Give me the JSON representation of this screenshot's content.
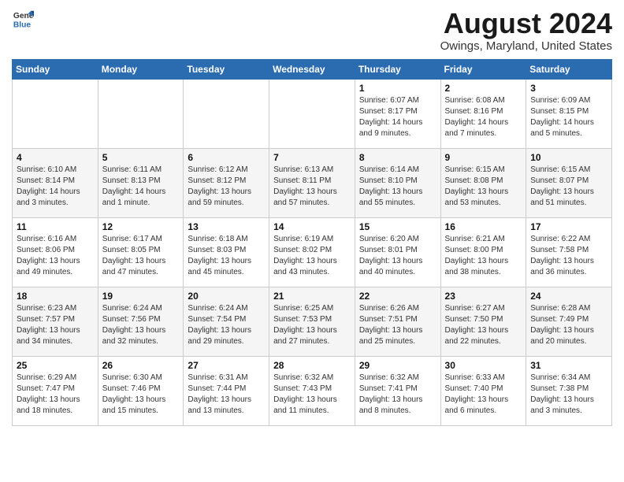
{
  "header": {
    "logo_general": "General",
    "logo_blue": "Blue",
    "title": "August 2024",
    "location": "Owings, Maryland, United States"
  },
  "days_of_week": [
    "Sunday",
    "Monday",
    "Tuesday",
    "Wednesday",
    "Thursday",
    "Friday",
    "Saturday"
  ],
  "weeks": [
    [
      {
        "day": "",
        "info": ""
      },
      {
        "day": "",
        "info": ""
      },
      {
        "day": "",
        "info": ""
      },
      {
        "day": "",
        "info": ""
      },
      {
        "day": "1",
        "info": "Sunrise: 6:07 AM\nSunset: 8:17 PM\nDaylight: 14 hours\nand 9 minutes."
      },
      {
        "day": "2",
        "info": "Sunrise: 6:08 AM\nSunset: 8:16 PM\nDaylight: 14 hours\nand 7 minutes."
      },
      {
        "day": "3",
        "info": "Sunrise: 6:09 AM\nSunset: 8:15 PM\nDaylight: 14 hours\nand 5 minutes."
      }
    ],
    [
      {
        "day": "4",
        "info": "Sunrise: 6:10 AM\nSunset: 8:14 PM\nDaylight: 14 hours\nand 3 minutes."
      },
      {
        "day": "5",
        "info": "Sunrise: 6:11 AM\nSunset: 8:13 PM\nDaylight: 14 hours\nand 1 minute."
      },
      {
        "day": "6",
        "info": "Sunrise: 6:12 AM\nSunset: 8:12 PM\nDaylight: 13 hours\nand 59 minutes."
      },
      {
        "day": "7",
        "info": "Sunrise: 6:13 AM\nSunset: 8:11 PM\nDaylight: 13 hours\nand 57 minutes."
      },
      {
        "day": "8",
        "info": "Sunrise: 6:14 AM\nSunset: 8:10 PM\nDaylight: 13 hours\nand 55 minutes."
      },
      {
        "day": "9",
        "info": "Sunrise: 6:15 AM\nSunset: 8:08 PM\nDaylight: 13 hours\nand 53 minutes."
      },
      {
        "day": "10",
        "info": "Sunrise: 6:15 AM\nSunset: 8:07 PM\nDaylight: 13 hours\nand 51 minutes."
      }
    ],
    [
      {
        "day": "11",
        "info": "Sunrise: 6:16 AM\nSunset: 8:06 PM\nDaylight: 13 hours\nand 49 minutes."
      },
      {
        "day": "12",
        "info": "Sunrise: 6:17 AM\nSunset: 8:05 PM\nDaylight: 13 hours\nand 47 minutes."
      },
      {
        "day": "13",
        "info": "Sunrise: 6:18 AM\nSunset: 8:03 PM\nDaylight: 13 hours\nand 45 minutes."
      },
      {
        "day": "14",
        "info": "Sunrise: 6:19 AM\nSunset: 8:02 PM\nDaylight: 13 hours\nand 43 minutes."
      },
      {
        "day": "15",
        "info": "Sunrise: 6:20 AM\nSunset: 8:01 PM\nDaylight: 13 hours\nand 40 minutes."
      },
      {
        "day": "16",
        "info": "Sunrise: 6:21 AM\nSunset: 8:00 PM\nDaylight: 13 hours\nand 38 minutes."
      },
      {
        "day": "17",
        "info": "Sunrise: 6:22 AM\nSunset: 7:58 PM\nDaylight: 13 hours\nand 36 minutes."
      }
    ],
    [
      {
        "day": "18",
        "info": "Sunrise: 6:23 AM\nSunset: 7:57 PM\nDaylight: 13 hours\nand 34 minutes."
      },
      {
        "day": "19",
        "info": "Sunrise: 6:24 AM\nSunset: 7:56 PM\nDaylight: 13 hours\nand 32 minutes."
      },
      {
        "day": "20",
        "info": "Sunrise: 6:24 AM\nSunset: 7:54 PM\nDaylight: 13 hours\nand 29 minutes."
      },
      {
        "day": "21",
        "info": "Sunrise: 6:25 AM\nSunset: 7:53 PM\nDaylight: 13 hours\nand 27 minutes."
      },
      {
        "day": "22",
        "info": "Sunrise: 6:26 AM\nSunset: 7:51 PM\nDaylight: 13 hours\nand 25 minutes."
      },
      {
        "day": "23",
        "info": "Sunrise: 6:27 AM\nSunset: 7:50 PM\nDaylight: 13 hours\nand 22 minutes."
      },
      {
        "day": "24",
        "info": "Sunrise: 6:28 AM\nSunset: 7:49 PM\nDaylight: 13 hours\nand 20 minutes."
      }
    ],
    [
      {
        "day": "25",
        "info": "Sunrise: 6:29 AM\nSunset: 7:47 PM\nDaylight: 13 hours\nand 18 minutes."
      },
      {
        "day": "26",
        "info": "Sunrise: 6:30 AM\nSunset: 7:46 PM\nDaylight: 13 hours\nand 15 minutes."
      },
      {
        "day": "27",
        "info": "Sunrise: 6:31 AM\nSunset: 7:44 PM\nDaylight: 13 hours\nand 13 minutes."
      },
      {
        "day": "28",
        "info": "Sunrise: 6:32 AM\nSunset: 7:43 PM\nDaylight: 13 hours\nand 11 minutes."
      },
      {
        "day": "29",
        "info": "Sunrise: 6:32 AM\nSunset: 7:41 PM\nDaylight: 13 hours\nand 8 minutes."
      },
      {
        "day": "30",
        "info": "Sunrise: 6:33 AM\nSunset: 7:40 PM\nDaylight: 13 hours\nand 6 minutes."
      },
      {
        "day": "31",
        "info": "Sunrise: 6:34 AM\nSunset: 7:38 PM\nDaylight: 13 hours\nand 3 minutes."
      }
    ]
  ]
}
